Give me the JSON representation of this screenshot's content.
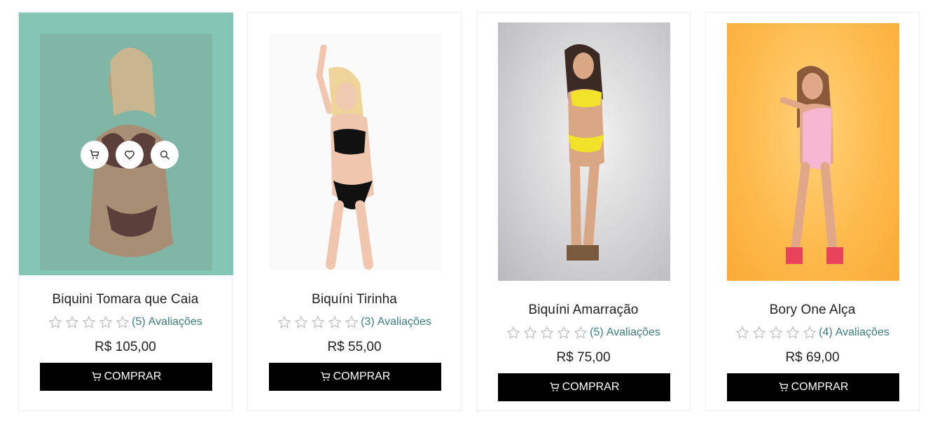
{
  "products": [
    {
      "name": "Biquini Tomara que Caia",
      "review_count": "(5)",
      "reviews_label": "Avaliações",
      "price": "R$ 105,00",
      "buy_label": "COMPRAR"
    },
    {
      "name": "Biquíni Tirinha",
      "review_count": "(3)",
      "reviews_label": "Avaliações",
      "price": "R$ 55,00",
      "buy_label": "COMPRAR"
    },
    {
      "name": "Biquíni Amarração",
      "review_count": "(5)",
      "reviews_label": "Avaliações",
      "price": "R$ 75,00",
      "buy_label": "COMPRAR"
    },
    {
      "name": "Bory One Alça",
      "review_count": "(4)",
      "reviews_label": "Avaliações",
      "price": "R$ 69,00",
      "buy_label": "COMPRAR"
    }
  ],
  "hover_actions": [
    "cart-icon",
    "heart-icon",
    "search-icon"
  ],
  "colors": {
    "hover_overlay": "#82c6b3",
    "button_bg": "#000000",
    "review_link": "#3c7d7a",
    "star_outline": "#b5b5b5"
  }
}
